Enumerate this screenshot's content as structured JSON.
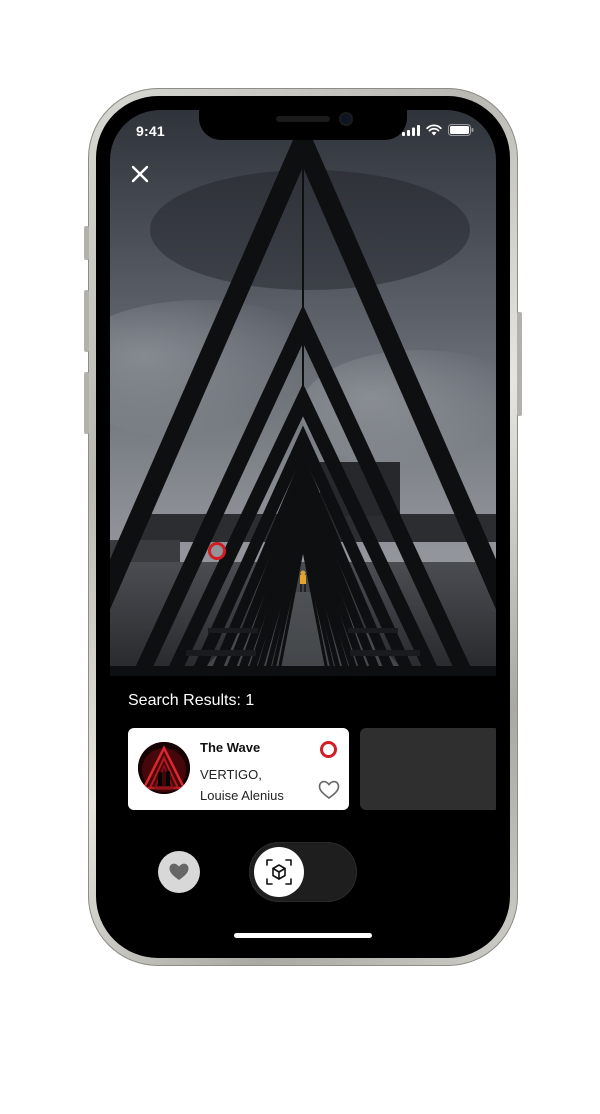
{
  "status_bar": {
    "time": "9:41"
  },
  "icons": {
    "close": "close-icon",
    "signal": "cellular-signal-icon",
    "wifi": "wifi-icon",
    "battery": "battery-icon",
    "hotspot": "target-marker-icon",
    "like": "heart-outline-icon",
    "favorites": "heart-filled-icon",
    "scan": "ar-scan-cube-icon"
  },
  "search": {
    "results_label": "Search Results: 1"
  },
  "results": [
    {
      "title": "The Wave",
      "artist_line1": "VERTIGO,",
      "artist_line2": "Louise Alenius"
    }
  ],
  "colors": {
    "accent": "#d21d25",
    "card_bg": "#ffffff",
    "screen_bg": "#000000"
  }
}
